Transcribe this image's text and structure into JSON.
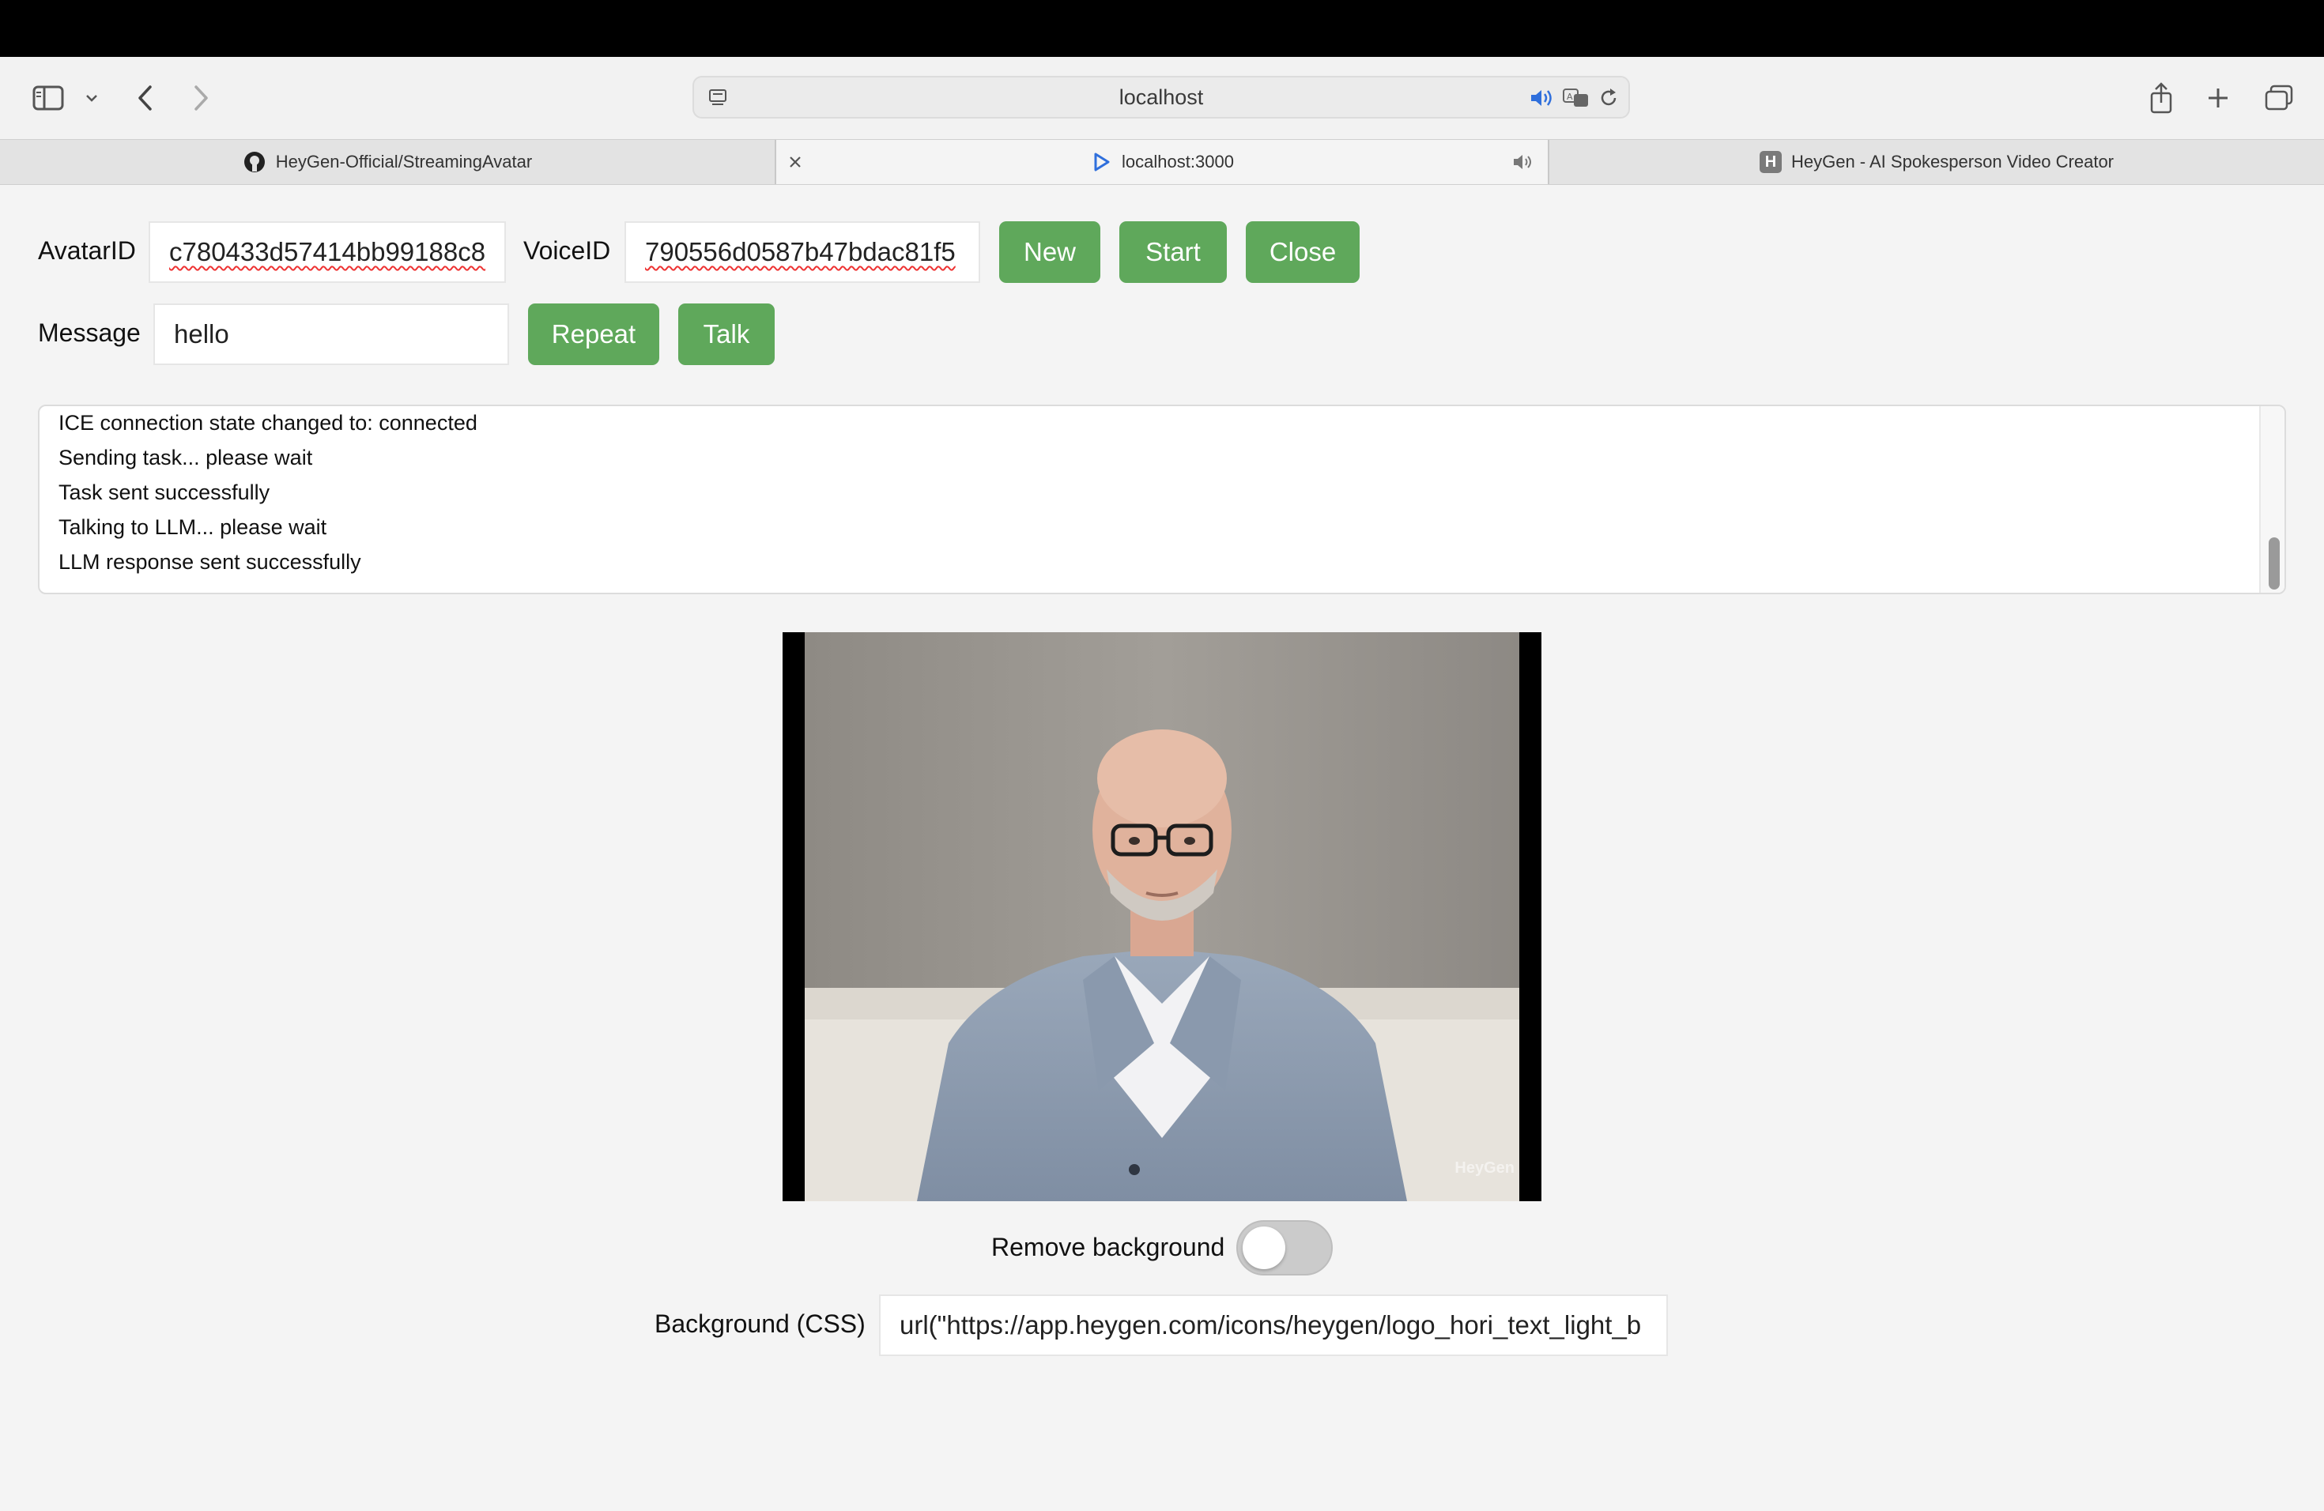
{
  "browser": {
    "url": "localhost",
    "tabs": [
      {
        "title": "HeyGen-Official/StreamingAvatar",
        "favicon": "github-icon"
      },
      {
        "title": "localhost:3000",
        "favicon": "heygen-play-icon"
      },
      {
        "title": "HeyGen - AI Spokesperson Video Creator",
        "favicon": "heygen-h-icon",
        "favicon_letter": "H"
      }
    ]
  },
  "controls": {
    "avatar_label": "AvatarID",
    "avatar_value": "c780433d57414bb99188c8",
    "voice_label": "VoiceID",
    "voice_value": "790556d0587b47bdac81f5",
    "new_label": "New",
    "start_label": "Start",
    "close_label": "Close",
    "message_label": "Message",
    "message_value": "hello",
    "repeat_label": "Repeat",
    "talk_label": "Talk"
  },
  "log": {
    "lines": [
      "ICE connection state changed to: connected",
      "Sending task... please wait",
      "Task sent successfully",
      "Talking to LLM... please wait",
      "LLM response sent successfully"
    ]
  },
  "video": {
    "watermark": "HeyGen"
  },
  "options": {
    "remove_bg_label": "Remove background",
    "remove_bg_enabled": false,
    "bg_css_label": "Background (CSS)",
    "bg_css_value": "url(\"https://app.heygen.com/icons/heygen/logo_hori_text_light_b"
  },
  "colors": {
    "button_green": "#5fa85b",
    "page_bg": "#f4f4f4"
  }
}
